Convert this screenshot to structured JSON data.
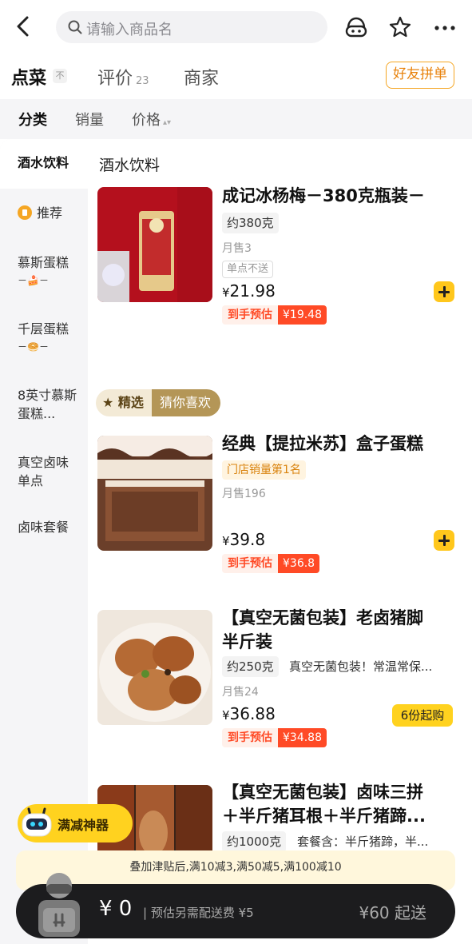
{
  "header": {
    "search_placeholder": "请输入商品名"
  },
  "tabs": [
    {
      "label": "点菜",
      "pin": "不"
    },
    {
      "label": "评价",
      "count": "23"
    },
    {
      "label": "商家"
    }
  ],
  "friend_order_label": "好友拼单",
  "filters": [
    "分类",
    "销量",
    "价格"
  ],
  "sidebar": {
    "items": [
      {
        "label": "酒水饮料"
      },
      {
        "label": "推荐"
      },
      {
        "label": "慕斯蛋糕",
        "emoji": "－🍰－"
      },
      {
        "label": "千层蛋糕",
        "emoji": "－🥯－"
      },
      {
        "label": "8英寸慕斯蛋糕..."
      },
      {
        "label": "真空卤味单点"
      },
      {
        "label": "卤味套餐"
      }
    ]
  },
  "section_title": "酒水饮料",
  "pick_badge": {
    "star": "精选",
    "text": "猜你喜欢"
  },
  "products": [
    {
      "name": "成记冰杨梅－380克瓶装－",
      "spec": "约380克",
      "sold": "月售3",
      "tag": "单点不送",
      "currency": "¥",
      "price": "21.98",
      "est_label": "到手预估",
      "est_price": "¥19.48"
    },
    {
      "name": "经典【提拉米苏】盒子蛋糕",
      "rank": "门店销量第1名",
      "sold": "月售196",
      "currency": "¥",
      "price": "39.8",
      "est_label": "到手预估",
      "est_price": "¥36.8"
    },
    {
      "name_line1": "【真空无菌包装】老卤猪脚",
      "name_line2": "半斤装",
      "spec": "约250克",
      "desc": "真空无菌包装！常温常保...",
      "sold": "月售24",
      "currency": "¥",
      "price": "36.88",
      "est_label": "到手预估",
      "est_price": "¥34.88",
      "min_buy": "6份起购"
    },
    {
      "name_line1": "【真空无菌包装】卤味三拼",
      "name_line2": "＋半斤猪耳根＋半斤猪蹄...",
      "spec": "约1000克",
      "desc": "套餐含：半斤猪蹄，半..."
    }
  ],
  "promo": {
    "tag_label": "满减神器",
    "strip_text": "叠加津贴后,满10减3,满50减5,满100减10"
  },
  "cart": {
    "amount": "¥ 0",
    "fee_text": "预估另需配送费 ¥5",
    "min_text": "¥60 起送"
  },
  "colors": {
    "accent_yellow": "#ffc71c",
    "price_red": "#ff4a26",
    "rank_orange": "#d9820c",
    "cart_bg": "#1c1c1e"
  }
}
